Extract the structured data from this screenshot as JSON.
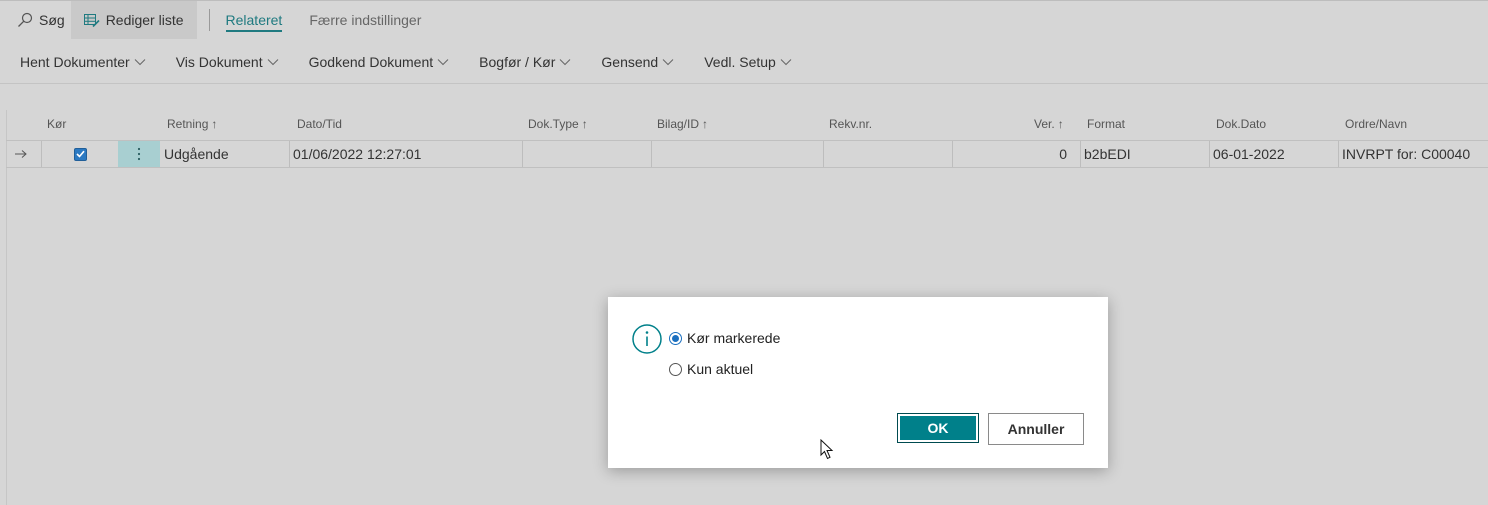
{
  "toolbar": {
    "search_label": "Søg",
    "edit_list_label": "Rediger liste",
    "tabs": [
      {
        "label": "Relateret",
        "active": true
      },
      {
        "label": "Færre indstillinger",
        "active": false
      }
    ]
  },
  "actions": [
    {
      "label": "Hent Dokumenter"
    },
    {
      "label": "Vis Dokument"
    },
    {
      "label": "Godkend Dokument"
    },
    {
      "label": "Bogfør / Kør"
    },
    {
      "label": "Gensend"
    },
    {
      "label": "Vedl. Setup"
    }
  ],
  "table": {
    "headers": {
      "kor": "Kør",
      "retning": "Retning",
      "dato_tid": "Dato/Tid",
      "dok_type": "Dok.Type",
      "bilag_id": "Bilag/ID",
      "rekv_nr": "Rekv.nr.",
      "ver": "Ver.",
      "format": "Format",
      "dok_dato": "Dok.Dato",
      "ordre_navn": "Ordre/Navn"
    },
    "sort_arrow": "↑",
    "row": {
      "kor_checked": true,
      "retning": "Udgående",
      "dato_tid": "01/06/2022 12:27:01",
      "dok_type": "",
      "bilag_id": "",
      "rekv_nr": "",
      "ver": "0",
      "format": "b2bEDI",
      "dok_dato": "06-01-2022",
      "ordre_navn": "INVRPT for: C00040"
    }
  },
  "dialog": {
    "options": [
      {
        "label": "Kør markerede",
        "selected": true
      },
      {
        "label": "Kun aktuel",
        "selected": false
      }
    ],
    "ok_label": "OK",
    "cancel_label": "Annuller"
  },
  "colors": {
    "accent": "#00808a",
    "checkbox": "#2b79c2",
    "background": "#d6d6d6"
  }
}
